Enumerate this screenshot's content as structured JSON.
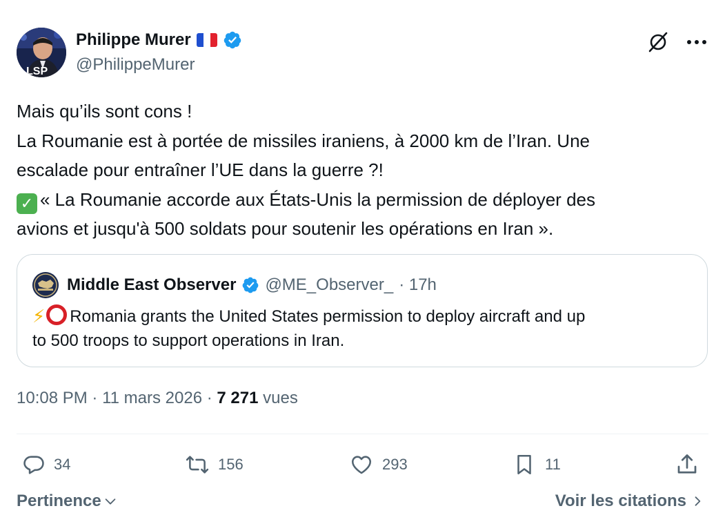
{
  "author": {
    "display_name": "Philippe Murer",
    "handle": "@PhilippeMurer",
    "flag": "french-flag",
    "verified": true
  },
  "tweet": {
    "lines": [
      "Mais qu’ils sont cons !",
      "La Roumanie est à portée de missiles iraniens, à 2000 km de l’Iran. Une",
      "escalade pour entraîner l’UE dans la guerre ?!",
      "« La Roumanie accorde aux États-Unis la permission de déployer des",
      "avions et jusqu'à 500 soldats pour soutenir les opérations en Iran »."
    ]
  },
  "quote": {
    "display_name": "Middle East Observer",
    "handle": "@ME_Observer_",
    "time": "· 17h",
    "line1": "Romania grants the United States permission to deploy aircraft and up",
    "line2": "to 500 troops to support operations in Iran."
  },
  "meta": {
    "time": "10:08 PM",
    "date": "11 mars 2026",
    "sep": "·",
    "views": "7 271",
    "views_label": "vues"
  },
  "actions": {
    "replies": "34",
    "reposts": "156",
    "likes": "293",
    "bookmarks": "11"
  },
  "footer": {
    "sort_label": "Pertinence",
    "quotes_label": "Voir les citations"
  },
  "colors": {
    "text": "#0f1419",
    "secondary": "#536471",
    "verified": "#1d9bf0",
    "border": "#cfd9de"
  }
}
